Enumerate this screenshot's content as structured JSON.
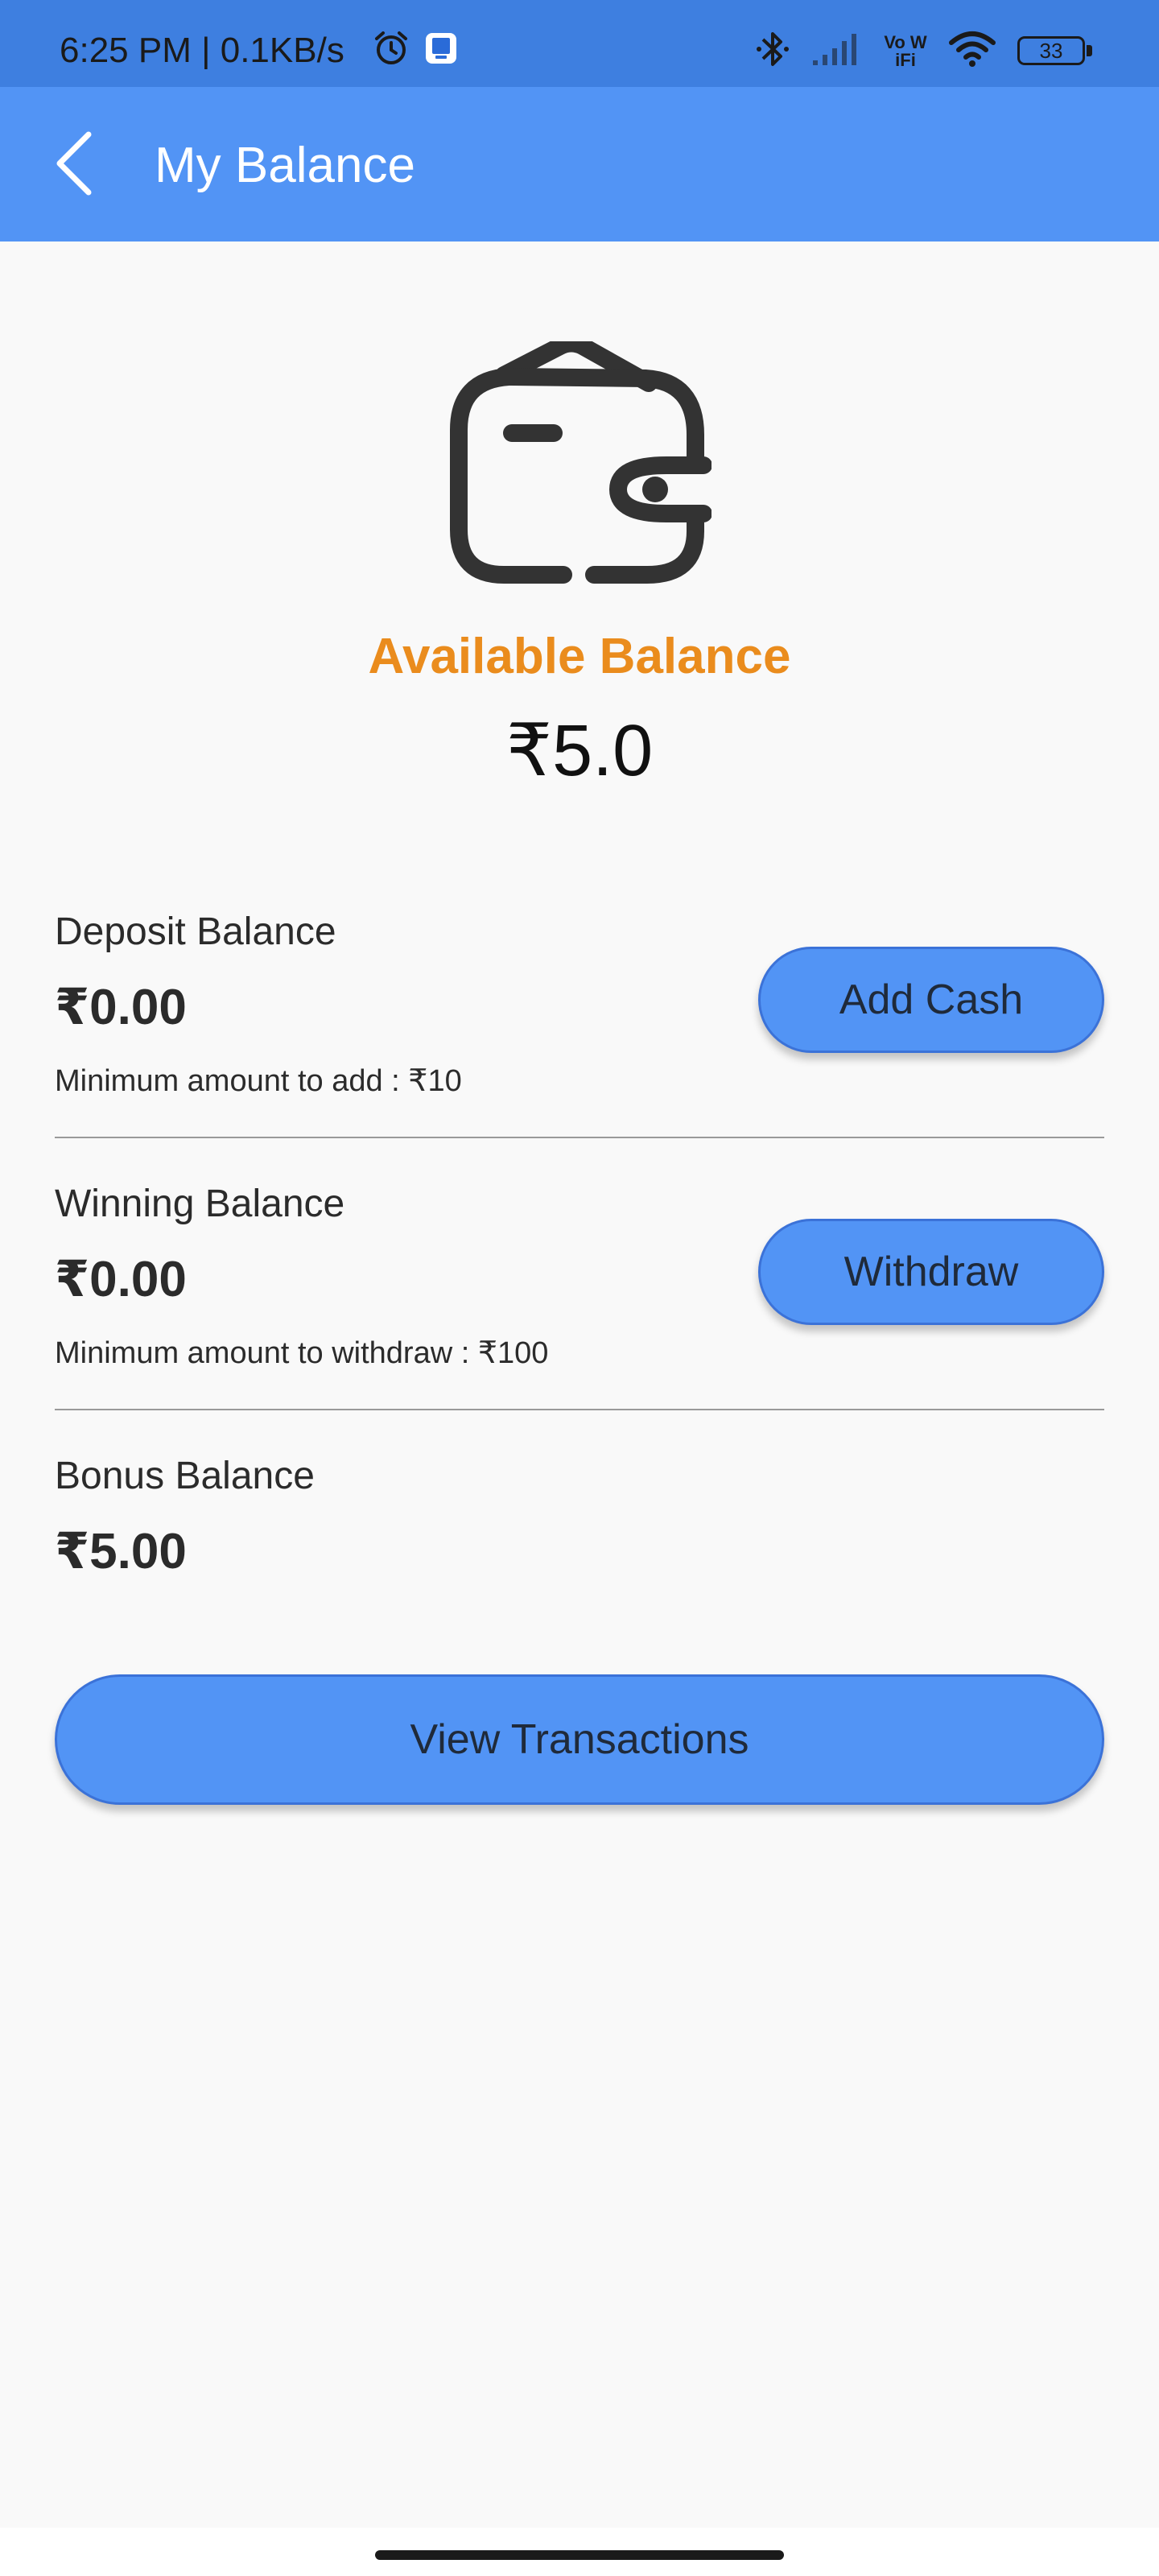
{
  "status_bar": {
    "time": "6:25 PM | 0.1KB/s",
    "battery": "33",
    "network_label": "Vo WiFi",
    "icons": [
      "alarm-icon",
      "app-notification-icon",
      "bluetooth-icon",
      "signal-icon",
      "vowifi-icon",
      "wifi-icon",
      "battery-icon"
    ]
  },
  "header": {
    "title": "My Balance",
    "back_icon": "back-arrow-icon"
  },
  "summary": {
    "label": "Available Balance",
    "amount": "₹5.0",
    "label_color": "#ea8c1d",
    "icon": "wallet-icon"
  },
  "deposit": {
    "title": "Deposit Balance",
    "amount": "₹0.00",
    "note": "Minimum amount to add : ₹10",
    "button_label": "Add Cash"
  },
  "winning": {
    "title": "Winning Balance",
    "amount": "₹0.00",
    "note": "Minimum amount to withdraw : ₹100",
    "button_label": "Withdraw"
  },
  "bonus": {
    "title": "Bonus Balance",
    "amount": "₹5.00"
  },
  "actions": {
    "view_transactions_label": "View Transactions"
  },
  "colors": {
    "app_bar": "#5294f5",
    "status_bar": "#3e7fe0",
    "button": "#5294f5",
    "accent": "#ea8c1d"
  }
}
